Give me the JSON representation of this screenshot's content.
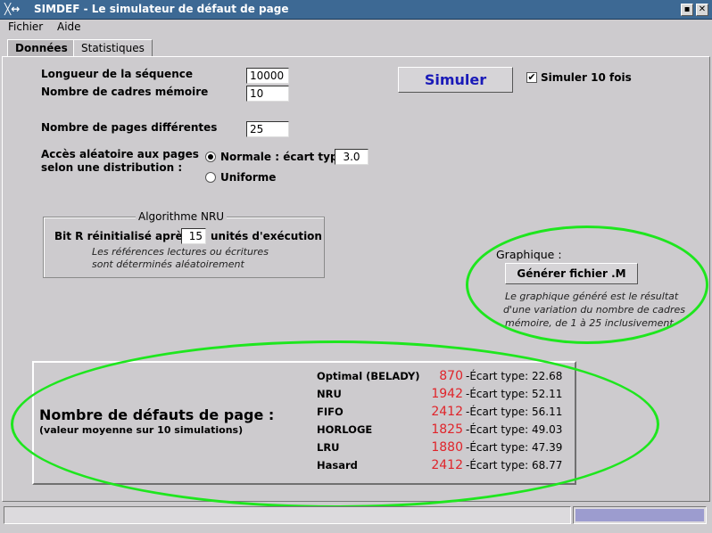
{
  "window": {
    "title": "SIMDEF - Le simulateur de défaut de page",
    "icon_glyph": "╳↔",
    "controls": [
      "▪",
      "✕"
    ]
  },
  "menu": [
    "Fichier",
    "Aide"
  ],
  "tabs": [
    {
      "label": "Données",
      "selected": true
    },
    {
      "label": "Statistiques",
      "selected": false
    }
  ],
  "params": {
    "sequence_length_label": "Longueur de la séquence",
    "sequence_length_value": "10000",
    "frames_label": "Nombre de cadres mémoire",
    "frames_value": "10",
    "pages_label": "Nombre de pages différentes",
    "pages_value": "25",
    "access_label_line1": "Accès aléatoire aux pages",
    "access_label_line2": "selon une distribution :",
    "radio_normal_label": "Normale : écart type",
    "radio_normal_selected": true,
    "std_dev_value": "3.0",
    "radio_uniform_label": "Uniforme",
    "radio_uniform_selected": false
  },
  "simulate": {
    "button_label": "Simuler",
    "button_color": "#1a1ab8",
    "checkbox_label": "Simuler 10 fois",
    "checkbox_checked": true,
    "check_glyph": "✔"
  },
  "nru": {
    "title": "Algorithme NRU",
    "reset_prefix": "Bit R réinitialisé après",
    "reset_value": "15",
    "reset_suffix": "unités d'exécution",
    "note_line1": "Les références lectures ou écritures",
    "note_line2": "sont déterminés aléatoirement"
  },
  "graph": {
    "title": "Graphique :",
    "button_label": "Générer fichier .M",
    "note_line1": "Le graphique généré est le résultat",
    "note_line2": "d'une variation du nombre de cadres",
    "note_line3": "mémoire, de 1 à 25 inclusivement"
  },
  "results": {
    "heading": "Nombre de défauts de page :",
    "subheading": "(valeur moyenne sur 10 simulations)",
    "value_color": "#e0242a",
    "rows": [
      {
        "name": "Optimal (BELADY)",
        "value": "870",
        "sd": "-Écart type: 22.68"
      },
      {
        "name": "NRU",
        "value": "1942",
        "sd": "-Écart type: 52.11"
      },
      {
        "name": "FIFO",
        "value": "2412",
        "sd": "-Écart type: 56.11"
      },
      {
        "name": "HORLOGE",
        "value": "1825",
        "sd": "-Écart type: 49.03"
      },
      {
        "name": "LRU",
        "value": "1880",
        "sd": "-Écart type: 47.39"
      },
      {
        "name": "Hasard",
        "value": "2412",
        "sd": "-Écart type: 68.77"
      }
    ]
  },
  "annotation_color": "#1ee61e",
  "progress_color": "#9c9ccf"
}
